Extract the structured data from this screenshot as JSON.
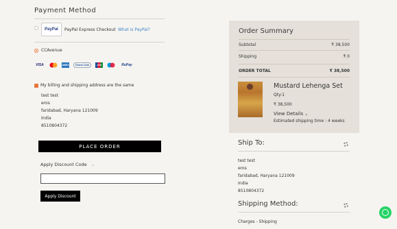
{
  "payment": {
    "title": "Payment Method",
    "paypal_logo": "PayPal",
    "paypal_label": "PayPal Express Checkout",
    "paypal_link": "What is PayPal?",
    "ccavenue_label": "CCAvenue",
    "cards": [
      "VISA",
      "MC",
      "AMEX",
      "Diners Club",
      "JCB",
      "Maestro",
      "RuPay"
    ],
    "billing_same_label": "My billing and shipping address are the same",
    "address": [
      "test test",
      "eros",
      "faridabad, Haryana 121009",
      "India",
      "8510804372"
    ],
    "place_order": "PLACE ORDER",
    "discount_label": "Apply Discount Code",
    "discount_placeholder": "",
    "apply_discount": "Apply Discount"
  },
  "summary": {
    "title": "Order Summary",
    "subtotal_label": "Subtotal",
    "subtotal_value": "₹ 38,500",
    "shipping_label": "Shipping",
    "shipping_value": "₹ 0",
    "total_label": "ORDER TOTAL",
    "total_value": "₹ 38,500",
    "product": {
      "name": "Mustard Lehenga Set",
      "qty": "Qty:1",
      "price": "₹ 38,500",
      "view_details": "View Details",
      "shipping_time": "Estimated shipping time : 4 weeks"
    }
  },
  "ship_to": {
    "title": "Ship To:",
    "address": [
      "test test",
      "eros",
      "faridabad, Haryana 121009",
      "India",
      "8510804372"
    ]
  },
  "shipping_method": {
    "title": "Shipping Method:",
    "charges": "Charges - Shipping"
  },
  "colors": {
    "accent": "#e6763c",
    "summary_bg": "#e5e0d9",
    "whatsapp": "#25d366"
  }
}
